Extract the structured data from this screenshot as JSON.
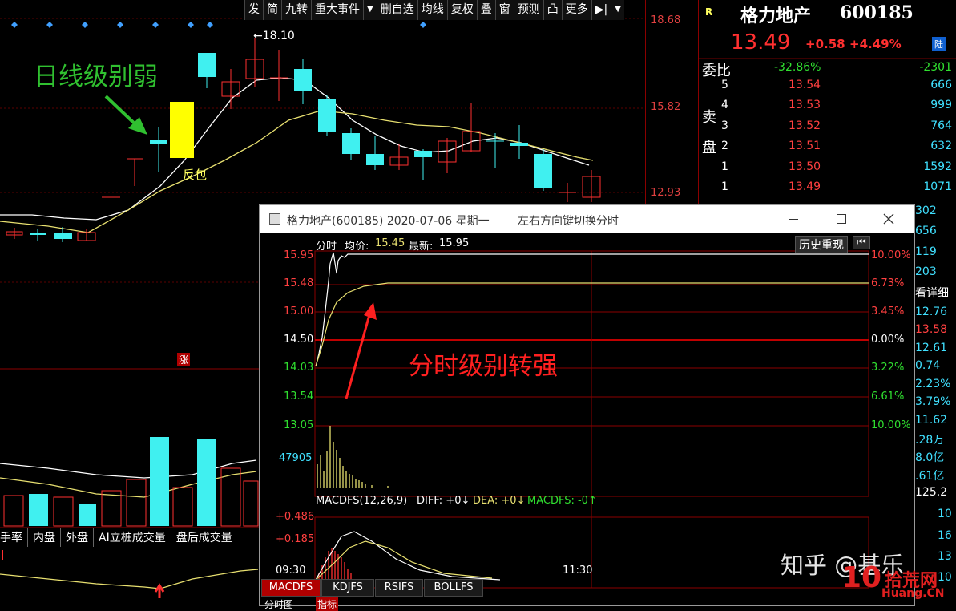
{
  "toolbar": [
    "发",
    "简",
    "九转",
    "重大事件",
    "▼",
    "删自选",
    "均线",
    "复权",
    "叠",
    "窗",
    "预测",
    "凸",
    "更多",
    "▶|",
    "▼"
  ],
  "price_axis": [
    "18.68",
    "15.82",
    "12.93"
  ],
  "main": {
    "annotation_weak": "日线级别弱",
    "annotation_reverse": "反包",
    "high_marker": "←18.10",
    "limit_badge": "涨",
    "labels_bottom": [
      "手率",
      "内盘",
      "外盘",
      "AI立桩成交量",
      "盘后成交量"
    ]
  },
  "quote": {
    "marker": "R",
    "name": "格力地产",
    "code": "600185",
    "price": "13.49",
    "change": "+0.58",
    "change_pct": "+4.49%",
    "tag": "陆",
    "wb_label": "委比",
    "wb_value": "-32.86%",
    "wb_diff": "-2301",
    "sell_label_1": "卖",
    "sell_label_2": "盘",
    "asks": [
      {
        "idx": "5",
        "price": "13.54",
        "vol": "666"
      },
      {
        "idx": "4",
        "price": "13.53",
        "vol": "999"
      },
      {
        "idx": "3",
        "price": "13.52",
        "vol": "764"
      },
      {
        "idx": "2",
        "price": "13.51",
        "vol": "632"
      },
      {
        "idx": "1",
        "price": "13.50",
        "vol": "1592"
      }
    ],
    "bid1": {
      "idx": "1",
      "price": "13.49",
      "vol": "1071"
    },
    "side_values": [
      {
        "text": "302",
        "color": "#40e0ff"
      },
      {
        "text": "656",
        "color": "#40e0ff"
      },
      {
        "text": "119",
        "color": "#40e0ff"
      },
      {
        "text": "203",
        "color": "#40e0ff"
      },
      {
        "text": "看详细",
        "color": "#ffffff"
      },
      {
        "text": "12.76",
        "color": "#40e0ff"
      },
      {
        "text": "13.58",
        "color": "#ff4040"
      },
      {
        "text": "12.61",
        "color": "#40e0ff"
      },
      {
        "text": "0.74",
        "color": "#40e0ff"
      },
      {
        "text": "2.23%",
        "color": "#40e0ff"
      },
      {
        "text": "3.79%",
        "color": "#40e0ff"
      },
      {
        "text": "11.62",
        "color": "#40e0ff"
      },
      {
        "text": ".28万",
        "color": "#40e0ff"
      },
      {
        "text": "8.0亿",
        "color": "#40e0ff"
      },
      {
        "text": ".61亿",
        "color": "#40e0ff"
      },
      {
        "text": "125.2",
        "color": "#ffffff"
      },
      {
        "text": "10",
        "color": "#40e0ff"
      },
      {
        "text": "16",
        "color": "#40e0ff"
      },
      {
        "text": "13",
        "color": "#40e0ff"
      },
      {
        "text": "10",
        "color": "#40e0ff"
      }
    ]
  },
  "popup": {
    "title": "格力地产(600185) 2020-07-06 星期一",
    "hint": "左右方向键切换分时",
    "header_label": "分时",
    "avg_label": "均价:",
    "avg_value": "15.45",
    "last_label": "最新:",
    "last_value": "15.95",
    "history_btn": "历史重现",
    "price_left": [
      "15.95",
      "15.48",
      "15.00",
      "14.50",
      "14.03",
      "13.54",
      "13.05"
    ],
    "pct_right": [
      "10.00%",
      "6.73%",
      "3.45%",
      "0.00%",
      "3.22%",
      "6.61%",
      "10.00%"
    ],
    "volume_label": "47905",
    "annotation_strong": "分时级别转强",
    "macd_header": "MACDFS(12,26,9)",
    "diff_text": "DIFF: +0↓",
    "dea_text": "DEA: +0↓",
    "macdfs_text": "MACDFS: -0↑",
    "macd_left": [
      "+0.486",
      "+0.185"
    ],
    "time_start": "09:30",
    "time_mid": "11:30"
  },
  "tabs": [
    "MACDFS",
    "KDJFS",
    "RSIFS",
    "BOLLFS"
  ],
  "tabs_lower": [
    "分时图",
    "指标"
  ],
  "watermark": {
    "zhihu": "知乎 @基乐",
    "site": "拾荒网",
    "site_en": "Huang.CN",
    "site_num": "10"
  },
  "colors": {
    "red": "#ff2020",
    "cyan": "#40f0f0",
    "yellow": "#ffff00",
    "green": "#30c030"
  }
}
